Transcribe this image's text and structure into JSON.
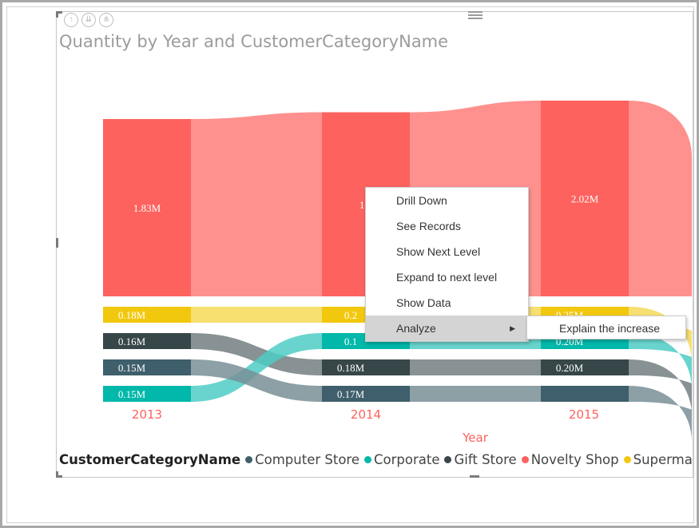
{
  "visual_title": "Quantity by Year and CustomerCategoryName",
  "toolbar": {
    "up_icon": "arrow-up-icon",
    "drill_icon": "drill-down-icon",
    "expand_icon": "expand-all-icon"
  },
  "legend": {
    "title": "CustomerCategoryName",
    "items": [
      {
        "label": "Computer Store",
        "color": "#3e5f6b"
      },
      {
        "label": "Corporate",
        "color": "#01b8aa"
      },
      {
        "label": "Gift Store",
        "color": "#374649"
      },
      {
        "label": "Novelty Shop",
        "color": "#fd625e"
      },
      {
        "label": "Supermark",
        "color": "#f2c80f"
      }
    ]
  },
  "context_menu": {
    "items": [
      "Drill Down",
      "See Records",
      "Show Next Level",
      "Expand to next level",
      "Show Data",
      "Analyze"
    ],
    "highlighted": "Analyze",
    "submenu": {
      "item": "Explain the increase"
    }
  },
  "chart_data": {
    "type": "ribbon",
    "title": "Quantity by Year and CustomerCategoryName",
    "xlabel": "Year",
    "categories": [
      "2013",
      "2014",
      "2015"
    ],
    "series": [
      {
        "name": "Novelty Shop",
        "color": "#fd625e",
        "values": [
          1.83,
          1.9,
          2.02
        ],
        "labels": [
          "1.83M",
          "1.9",
          "2.02M"
        ]
      },
      {
        "name": "Supermark",
        "color": "#f2c80f",
        "values": [
          0.18,
          0.2,
          0.25
        ],
        "labels": [
          "0.18M",
          "0.2",
          "0.25M"
        ]
      },
      {
        "name": "Gift Store",
        "color": "#374649",
        "values": [
          0.16,
          0.18,
          0.2
        ],
        "labels": [
          "0.16M",
          "0.18M",
          "0.20M"
        ]
      },
      {
        "name": "Corporate",
        "color": "#01b8aa",
        "values": [
          0.15,
          0.19,
          0.2
        ],
        "labels": [
          "0.15M",
          "0.1",
          "0.20M"
        ]
      },
      {
        "name": "Computer Store",
        "color": "#3e5f6b",
        "values": [
          0.15,
          0.17,
          0.19
        ],
        "labels": [
          "0.15M",
          "0.17M",
          ""
        ]
      }
    ],
    "unit": "M",
    "legend_position": "bottom"
  }
}
